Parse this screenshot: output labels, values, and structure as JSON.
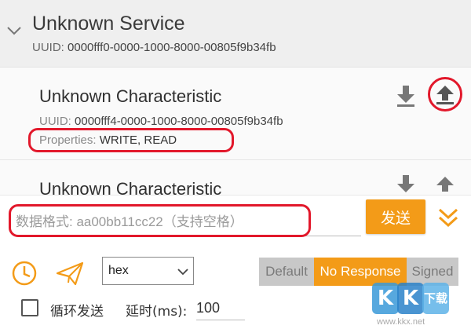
{
  "service": {
    "title": "Unknown Service",
    "uuid_label": "UUID:",
    "uuid_value": "0000fff0-0000-1000-8000-00805f9b34fb"
  },
  "characteristic_1": {
    "title": "Unknown Characteristic",
    "uuid_label": "UUID:",
    "uuid_value": "0000fff4-0000-1000-8000-00805f9b34fb",
    "properties_label": "Properties:",
    "properties_value": "WRITE, READ"
  },
  "characteristic_2": {
    "title": "Unknown Characteristic"
  },
  "send_panel": {
    "input_placeholder": "数据格式: aa00bb11cc22（支持空格）",
    "send_label": "发送",
    "format_select": "hex",
    "write_types": {
      "default": "Default",
      "no_response": "No Response",
      "signed": "Signed",
      "selected": "No Response"
    },
    "loop_send_label": "循环发送",
    "delay_label": "延时(ms):",
    "delay_value": "100"
  },
  "watermark": {
    "letter_1": "K",
    "letter_2": "K",
    "letter_3": "下载",
    "url": "www.kkx.net"
  },
  "colors": {
    "accent": "#f39b18",
    "highlight": "#e2182b",
    "segment_inactive": "#c8c8c8"
  },
  "icons": {
    "collapse": "chevron-down-icon",
    "read": "download-icon",
    "write": "upload-icon",
    "expand": "double-chevron-down-icon",
    "timer": "clock-icon",
    "send_mode": "paper-plane-icon",
    "dropdown": "triangle-down-icon"
  }
}
